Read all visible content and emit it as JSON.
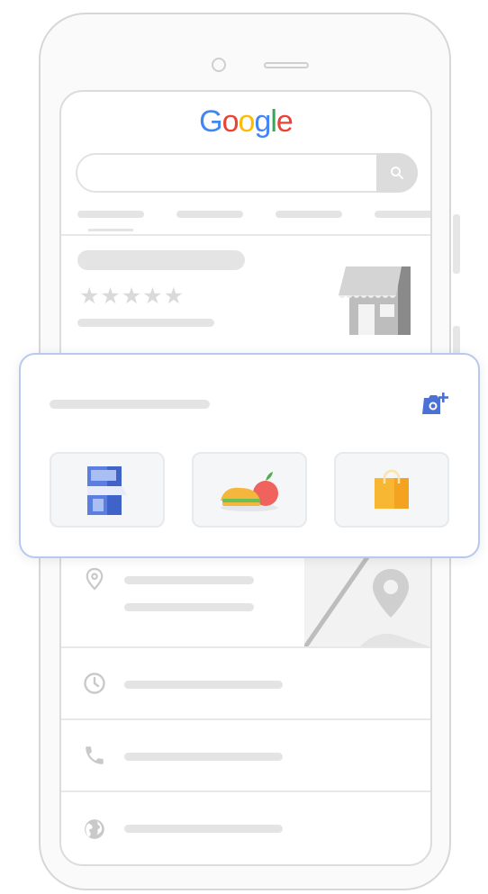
{
  "app": {
    "logo_letters": [
      "G",
      "o",
      "o",
      "g",
      "l",
      "e"
    ],
    "logo_colors": [
      "#4285F4",
      "#EA4335",
      "#FBBC05",
      "#4285F4",
      "#34A853",
      "#EA4335"
    ]
  },
  "business": {
    "rating_stars": "★★★★★"
  },
  "icons": {
    "search": "search-icon",
    "storefront": "storefront-icon",
    "add_photo": "add-photo-icon",
    "location": "location-pin-icon",
    "map": "map-icon",
    "hours": "clock-icon",
    "phone": "phone-icon",
    "website": "globe-icon"
  },
  "categories": [
    {
      "name": "storefront-photo-tile"
    },
    {
      "name": "food-photo-tile"
    },
    {
      "name": "product-photo-tile"
    }
  ],
  "colors": {
    "accent": "#4B70D6",
    "card_border": "#B9C8EF"
  }
}
